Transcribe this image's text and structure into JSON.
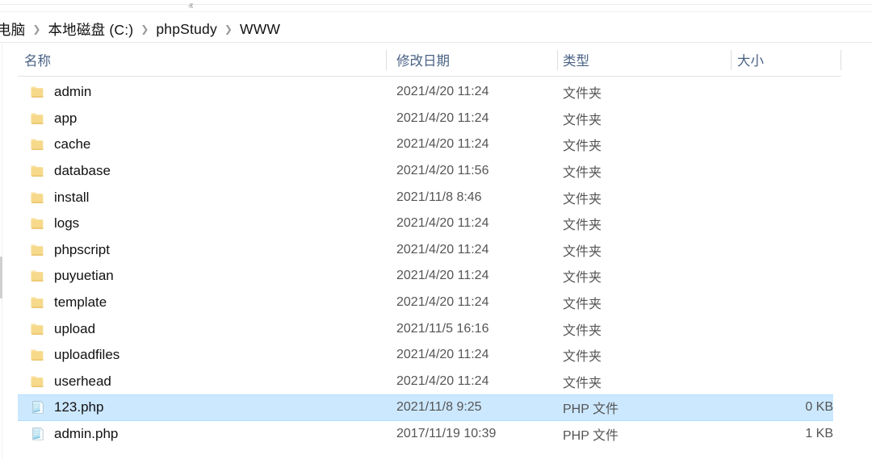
{
  "window": {
    "app": "Windows File Explorer",
    "accent_selection": "#cce8ff",
    "header_text_color": "#4a6285"
  },
  "breadcrumb": {
    "name": "address-breadcrumb",
    "separator": "❯",
    "items": [
      {
        "label": "电脑"
      },
      {
        "label": "本地磁盘 (C:)"
      },
      {
        "label": "phpStudy"
      },
      {
        "label": "WWW"
      }
    ]
  },
  "columns": {
    "sort_indicator": "ⱏ",
    "sorted_by": "名称",
    "sort_direction": "ascending",
    "headers": [
      {
        "key": "name",
        "label": "名称"
      },
      {
        "key": "date",
        "label": "修改日期"
      },
      {
        "key": "type",
        "label": "类型"
      },
      {
        "key": "size",
        "label": "大小"
      }
    ]
  },
  "files": [
    {
      "name": "admin",
      "date": "2021/4/20 11:24",
      "type": "文件夹",
      "size": "",
      "icon": "folder-icon",
      "selected": false
    },
    {
      "name": "app",
      "date": "2021/4/20 11:24",
      "type": "文件夹",
      "size": "",
      "icon": "folder-icon",
      "selected": false
    },
    {
      "name": "cache",
      "date": "2021/4/20 11:24",
      "type": "文件夹",
      "size": "",
      "icon": "folder-icon",
      "selected": false
    },
    {
      "name": "database",
      "date": "2021/4/20 11:56",
      "type": "文件夹",
      "size": "",
      "icon": "folder-icon",
      "selected": false
    },
    {
      "name": "install",
      "date": "2021/11/8 8:46",
      "type": "文件夹",
      "size": "",
      "icon": "folder-icon",
      "selected": false
    },
    {
      "name": "logs",
      "date": "2021/4/20 11:24",
      "type": "文件夹",
      "size": "",
      "icon": "folder-icon",
      "selected": false
    },
    {
      "name": "phpscript",
      "date": "2021/4/20 11:24",
      "type": "文件夹",
      "size": "",
      "icon": "folder-icon",
      "selected": false
    },
    {
      "name": "puyuetian",
      "date": "2021/4/20 11:24",
      "type": "文件夹",
      "size": "",
      "icon": "folder-icon",
      "selected": false
    },
    {
      "name": "template",
      "date": "2021/4/20 11:24",
      "type": "文件夹",
      "size": "",
      "icon": "folder-icon",
      "selected": false
    },
    {
      "name": "upload",
      "date": "2021/11/5 16:16",
      "type": "文件夹",
      "size": "",
      "icon": "folder-icon",
      "selected": false
    },
    {
      "name": "uploadfiles",
      "date": "2021/4/20 11:24",
      "type": "文件夹",
      "size": "",
      "icon": "folder-icon",
      "selected": false
    },
    {
      "name": "userhead",
      "date": "2021/4/20 11:24",
      "type": "文件夹",
      "size": "",
      "icon": "folder-icon",
      "selected": false
    },
    {
      "name": "123.php",
      "date": "2021/11/8 9:25",
      "type": "PHP 文件",
      "size": "0 KB",
      "icon": "php-file-icon",
      "selected": true
    },
    {
      "name": "admin.php",
      "date": "2017/11/19 10:39",
      "type": "PHP 文件",
      "size": "1 KB",
      "icon": "php-file-icon",
      "selected": false
    }
  ]
}
